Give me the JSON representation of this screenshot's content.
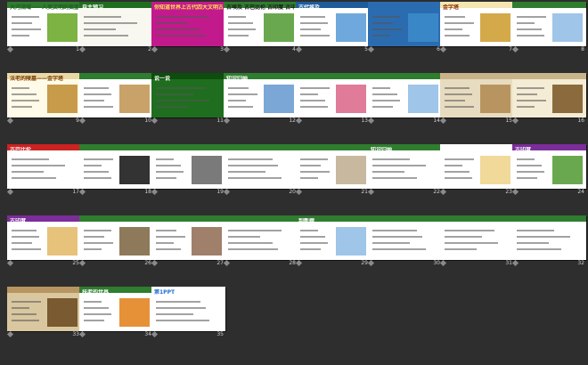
{
  "slides": [
    {
      "num": "1",
      "bg": "#ffffff",
      "bar": "#2f7d2f",
      "title": "大河流域——人类文明的摇篮",
      "tc": "#1f5d1f",
      "pic": "#7cb342"
    },
    {
      "num": "2",
      "bg": "#f8f8f0",
      "bar": "#1f6e1f",
      "title": "自主预习",
      "tc": "#ffffff",
      "pic": ""
    },
    {
      "num": "3",
      "bg": "#c21a8c",
      "bar": "#c21a8c",
      "title": "你知道世界上古代四大文明古国吗？",
      "tc": "#ffe24a",
      "pic": ""
    },
    {
      "num": "4",
      "bg": "#ffffff",
      "bar": "#2f7d2f",
      "title": "古埃及 古巴比伦 古印度 古中国",
      "tc": "#1a1a1a",
      "pic": "#6aa84f"
    },
    {
      "num": "5",
      "bg": "#ffffff",
      "bar": "#1f5d9a",
      "title": "古代埃及",
      "tc": "#ffffff",
      "pic": "#6fa8dc"
    },
    {
      "num": "6",
      "bg": "#2b6cb0",
      "bar": "#2b6cb0",
      "title": "",
      "tc": "#ffffff",
      "pic": "#3a87c8"
    },
    {
      "num": "7",
      "bg": "#ffffff",
      "bar": "#f3e6b0",
      "title": "金字塔",
      "tc": "#8a2a00",
      "pic": "#d4a94a"
    },
    {
      "num": "8",
      "bg": "#ffffff",
      "bar": "#2f7d2f",
      "title": "",
      "tc": "#1a1a1a",
      "pic": "#9fc5e8"
    },
    {
      "num": "9",
      "bg": "#fffbe8",
      "bar": "#e9d8a6",
      "title": "法老的陵墓——金字塔",
      "tc": "#7a3b00",
      "pic": "#c89b4a"
    },
    {
      "num": "10",
      "bg": "#ffffff",
      "bar": "#2f7d2f",
      "title": "",
      "tc": "#1a1a1a",
      "pic": "#c9a26a"
    },
    {
      "num": "11",
      "bg": "#1f6e1f",
      "bar": "#0d4d0d",
      "title": "说一说",
      "tc": "#ffffff",
      "pic": ""
    },
    {
      "num": "12",
      "bg": "#ffffff",
      "bar": "#2f7d2f",
      "title": "知识归纳",
      "tc": "#ffffff",
      "pic": "#7aa7d6"
    },
    {
      "num": "13",
      "bg": "#ffffff",
      "bar": "#2f7d2f",
      "title": "",
      "tc": "#1a1a1a",
      "pic": "#e07b9a"
    },
    {
      "num": "14",
      "bg": "#ffffff",
      "bar": "#2f7d2f",
      "title": "",
      "tc": "#1a1a1a",
      "pic": "#9fc5e8"
    },
    {
      "num": "15",
      "bg": "#e8dcc0",
      "bar": "#c9b48a",
      "title": "",
      "tc": "#1a1a1a",
      "pic": "#b89560"
    },
    {
      "num": "16",
      "bg": "#f4ecd4",
      "bar": "#c9b48a",
      "title": "",
      "tc": "#1a1a1a",
      "pic": "#8b6b3d"
    },
    {
      "num": "17",
      "bg": "#ffffff",
      "bar": "#cc2222",
      "title": "古巴比伦",
      "tc": "#ffffff",
      "pic": ""
    },
    {
      "num": "18",
      "bg": "#ffffff",
      "bar": "#2f7d2f",
      "title": "",
      "tc": "#1a1a1a",
      "pic": "#333333"
    },
    {
      "num": "19",
      "bg": "#ffffff",
      "bar": "#2f7d2f",
      "title": "",
      "tc": "#1a1a1a",
      "pic": "#7a7a7a"
    },
    {
      "num": "20",
      "bg": "#ffffff",
      "bar": "#2f7d2f",
      "title": "",
      "tc": "#1a1a1a",
      "pic": ""
    },
    {
      "num": "21",
      "bg": "#ffffff",
      "bar": "#2f7d2f",
      "title": "",
      "tc": "#1a1a1a",
      "pic": "#c8b8a0"
    },
    {
      "num": "22",
      "bg": "#ffffff",
      "bar": "#2f7d2f",
      "title": "知识归纳",
      "tc": "#ffffff",
      "pic": ""
    },
    {
      "num": "23",
      "bg": "#ffffff",
      "bar": "#ffffff",
      "title": "",
      "tc": "#1a1a1a",
      "pic": "#f1d99a"
    },
    {
      "num": "24",
      "bg": "#ffffff",
      "bar": "#7b2d9a",
      "title": "古印度",
      "tc": "#ffffff",
      "pic": "#6aa84f"
    },
    {
      "num": "25",
      "bg": "#ffffff",
      "bar": "#7b2d9a",
      "title": "古印度",
      "tc": "#ffffff",
      "pic": "#e7c27a"
    },
    {
      "num": "26",
      "bg": "#ffffff",
      "bar": "#2f7d2f",
      "title": "",
      "tc": "#1a1a1a",
      "pic": "#8e7a5a"
    },
    {
      "num": "27",
      "bg": "#ffffff",
      "bar": "#2f7d2f",
      "title": "",
      "tc": "#1a1a1a",
      "pic": "#a0806a"
    },
    {
      "num": "28",
      "bg": "#ffffff",
      "bar": "#2f7d2f",
      "title": "",
      "tc": "#1a1a1a",
      "pic": ""
    },
    {
      "num": "29",
      "bg": "#ffffff",
      "bar": "#2f7d2f",
      "title": "判断题",
      "tc": "#ffffff",
      "pic": "#9fc5e8"
    },
    {
      "num": "30",
      "bg": "#ffffff",
      "bar": "#2f7d2f",
      "title": "",
      "tc": "#1a1a1a",
      "pic": ""
    },
    {
      "num": "31",
      "bg": "#ffffff",
      "bar": "#2f7d2f",
      "title": "",
      "tc": "#1a1a1a",
      "pic": ""
    },
    {
      "num": "32",
      "bg": "#ffffff",
      "bar": "#2f7d2f",
      "title": "",
      "tc": "#1a1a1a",
      "pic": ""
    },
    {
      "num": "33",
      "bg": "#d9c7a0",
      "bar": "#b89560",
      "title": "",
      "tc": "#1a1a1a",
      "pic": "#7a5a30"
    },
    {
      "num": "34",
      "bg": "#ffffff",
      "bar": "#2f7d2f",
      "title": "扶老的世界",
      "tc": "#ffffff",
      "pic": "#e69138"
    },
    {
      "num": "35",
      "bg": "#ffffff",
      "bar": "#ffffff",
      "title": "第1PPT",
      "tc": "#1f6fd6",
      "pic": ""
    }
  ]
}
